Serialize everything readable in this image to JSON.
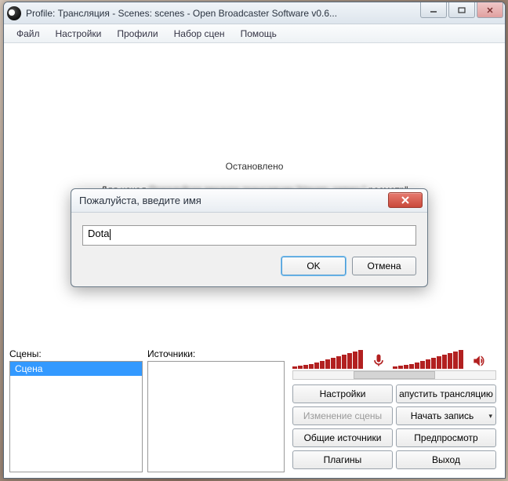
{
  "window": {
    "title": "Profile: Трансляция - Scenes: scenes - Open Broadcaster Software v0.6..."
  },
  "menu": {
    "file": "Файл",
    "settings": "Настройки",
    "profiles": "Профили",
    "scene_sets": "Набор сцен",
    "help": "Помощь"
  },
  "status": {
    "stopped": "Остановлено",
    "hint_prefix": "Для начал",
    "hint_blur": "Пожалуйста введите трансляции \"Начать запись\"",
    "hint_suffix": "росмотр\""
  },
  "panels": {
    "scenes_label": "Сцены:",
    "sources_label": "Источники:",
    "scene_item": "Сцена"
  },
  "buttons": {
    "settings": "Настройки",
    "start_stream": "апустить трансляцию",
    "edit_scene": "Изменение сцены",
    "start_record": "Начать запись",
    "global_sources": "Общие источники",
    "preview": "Предпросмотр",
    "plugins": "Плагины",
    "exit": "Выход"
  },
  "dialog": {
    "title": "Пожалуйста, введите имя",
    "value": "Dota",
    "ok": "OK",
    "cancel": "Отмена"
  },
  "colors": {
    "meter": "#b22020",
    "selection": "#3399ff"
  }
}
